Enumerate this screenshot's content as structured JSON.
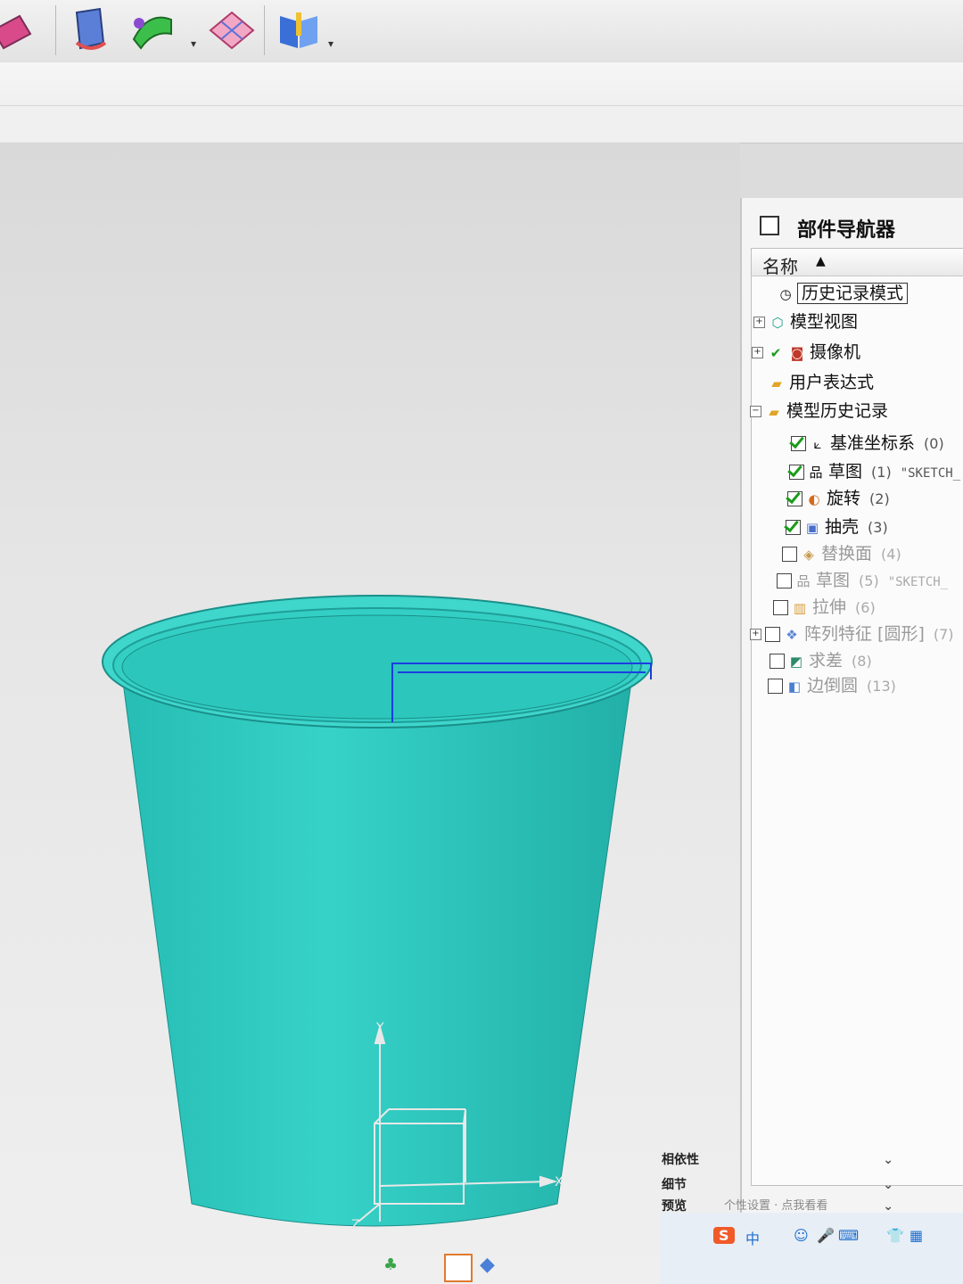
{
  "toolbar": {
    "icons": [
      "surface-icon",
      "bend-icon",
      "patch-icon",
      "grid-surface-icon",
      "book-icon"
    ],
    "dropdown_glyph": "▾"
  },
  "viewport": {
    "model": "cup",
    "model_color": "#2ecac0",
    "axis_labels": {
      "y": "Y",
      "x": "X",
      "z": "Z"
    }
  },
  "navigator": {
    "title": "部件导航器",
    "column_header": "名称",
    "sort_glyph": "▲",
    "items": [
      {
        "label": "历史记录模式",
        "icon": "clock-icon",
        "expander": "",
        "checked": null,
        "dim": false,
        "selected": true
      },
      {
        "label": "模型视图",
        "icon": "view-icon",
        "expander": "+",
        "checked": null,
        "dim": false
      },
      {
        "label": "摄像机",
        "icon": "camera-icon",
        "expander": "+",
        "checked": true,
        "dim": false
      },
      {
        "label": "用户表达式",
        "icon": "folder-icon",
        "expander": "",
        "checked": null,
        "dim": false
      },
      {
        "label": "模型历史记录",
        "icon": "folder-icon",
        "expander": "−",
        "checked": null,
        "dim": false
      },
      {
        "label": "基准坐标系",
        "num": "(0)",
        "icon": "datum-csys-icon",
        "checked": true,
        "dim": false
      },
      {
        "label": "草图",
        "num": "(1)",
        "extra": "\"SKETCH_",
        "icon": "sketch-icon",
        "checked": true,
        "dim": false
      },
      {
        "label": "旋转",
        "num": "(2)",
        "icon": "revolve-icon",
        "checked": true,
        "dim": false
      },
      {
        "label": "抽壳",
        "num": "(3)",
        "icon": "shell-icon",
        "checked": true,
        "dim": false
      },
      {
        "label": "替换面",
        "num": "(4)",
        "icon": "replace-face-icon",
        "checked": false,
        "dim": true
      },
      {
        "label": "草图",
        "num": "(5)",
        "extra": "\"SKETCH_",
        "icon": "sketch-icon",
        "checked": false,
        "dim": true
      },
      {
        "label": "拉伸",
        "num": "(6)",
        "icon": "extrude-icon",
        "checked": false,
        "dim": true
      },
      {
        "label": "阵列特征 [圆形]",
        "num": "(7)",
        "icon": "pattern-icon",
        "checked": false,
        "dim": true,
        "expander": "+"
      },
      {
        "label": "求差",
        "num": "(8)",
        "icon": "subtract-icon",
        "checked": false,
        "dim": true
      },
      {
        "label": "边倒圆",
        "num": "(13)",
        "icon": "edge-blend-icon",
        "checked": false,
        "dim": true
      }
    ],
    "panels": [
      "相依性",
      "细节",
      "预览"
    ],
    "preview_hint": "个性设置 · 点我看看"
  },
  "taskbar": {
    "ime": "中",
    "logo": "S"
  },
  "colors": {
    "cup": "#2ecac0",
    "cup_dark": "#1fa9a2",
    "check": "#1a9b1a",
    "sketch_line": "#1b3fe0"
  }
}
